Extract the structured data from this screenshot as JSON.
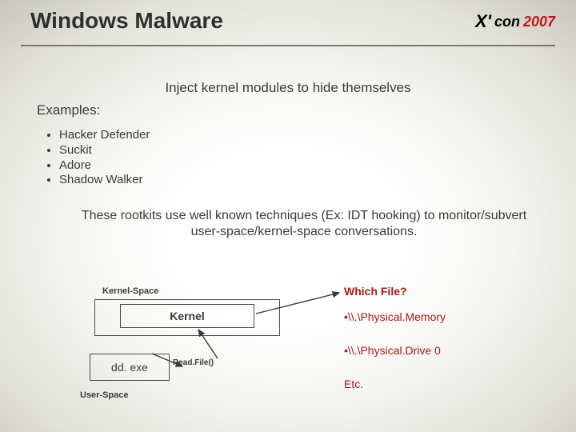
{
  "header": {
    "title": "Windows Malware",
    "logo_brand_x": "X'",
    "logo_brand_text": "con",
    "logo_year": "2007"
  },
  "body": {
    "subtitle": "Inject kernel modules to hide themselves",
    "examples_label": "Examples:",
    "examples": [
      "Hacker Defender",
      "Suckit",
      "Adore",
      "Shadow Walker"
    ],
    "explanation": "These rootkits use well known techniques (Ex: IDT hooking) to monitor/subvert user-space/kernel-space conversations."
  },
  "diagram": {
    "kernel_space_label": "Kernel-Space",
    "kernel_box": "Kernel",
    "readfile_label": "Read.File()",
    "dd_box": "dd. exe",
    "user_space_label": "User-Space",
    "which_file": "Which File?",
    "files": [
      "•\\\\.\\Physical.Memory",
      "•\\\\.\\Physical.Drive 0",
      "Etc."
    ]
  }
}
